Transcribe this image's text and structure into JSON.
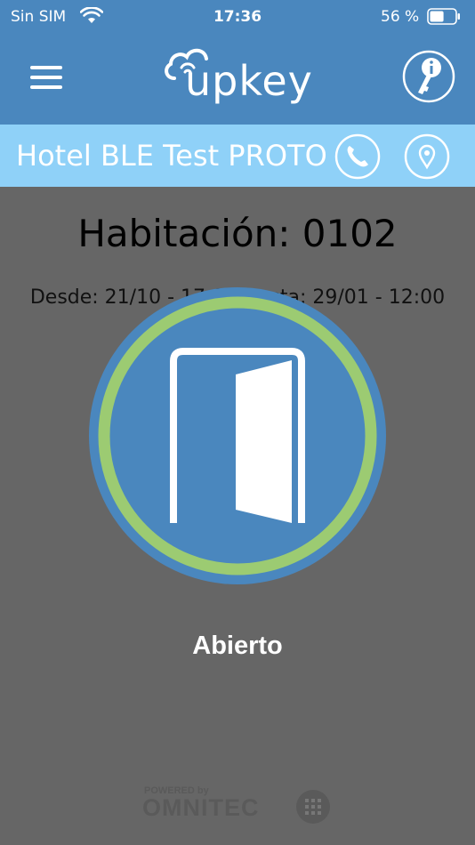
{
  "status_bar": {
    "carrier": "Sin SIM",
    "time": "17:36",
    "battery_percent": "56 %",
    "battery_level": 0.56
  },
  "header": {
    "logo_text": "upkey"
  },
  "hotel": {
    "name": "Hotel BLE Test PROTO"
  },
  "room": {
    "title": "Habitación: 0102",
    "dates": "Desde: 21/10 - 17:00 Hasta: 29/01 - 12:00"
  },
  "door": {
    "status_label": "Abierto"
  },
  "footer": {
    "powered_by": "POWERED by",
    "brand": "OMNITEC"
  },
  "colors": {
    "header_blue": "#4a87be",
    "hotel_bar": "#8fd1f8",
    "ring_green": "#9ccb72",
    "overlay_gray": "#666666"
  }
}
